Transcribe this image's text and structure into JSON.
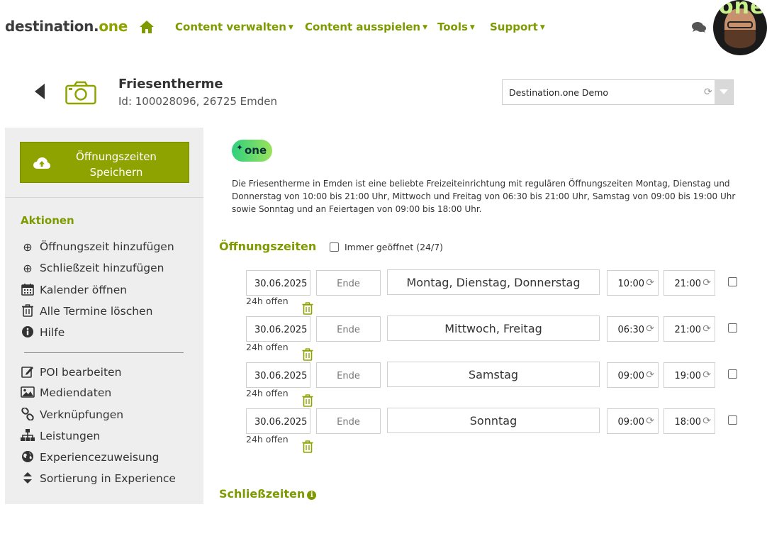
{
  "header": {
    "logo_main": "destination.",
    "logo_accent": "one",
    "nav": [
      {
        "label": "Content verwalten"
      },
      {
        "label": "Content ausspielen"
      },
      {
        "label": "Tools"
      },
      {
        "label": "Support"
      }
    ],
    "avatar_badge": "one"
  },
  "poi": {
    "title": "Friesentherme",
    "id_line": "Id: 100028096, 26725 Emden",
    "experience_value": "Destination.one Demo"
  },
  "sidebar": {
    "save_label": "Öffnungszeiten Speichern",
    "actions_heading": "Aktionen",
    "actions": [
      {
        "label": "Öffnungszeit hinzufügen",
        "icon": "plus-circle-icon"
      },
      {
        "label": "Schließzeit hinzufügen",
        "icon": "plus-circle-icon"
      },
      {
        "label": "Kalender öffnen",
        "icon": "calendar-icon"
      },
      {
        "label": "Alle Termine löschen",
        "icon": "trash-icon"
      },
      {
        "label": "Hilfe",
        "icon": "info-circle-icon"
      }
    ],
    "links": [
      {
        "label": "POI bearbeiten",
        "icon": "edit-icon"
      },
      {
        "label": "Mediendaten",
        "icon": "image-icon"
      },
      {
        "label": "Verknüpfungen",
        "icon": "link-icon"
      },
      {
        "label": "Leistungen",
        "icon": "sitemap-icon"
      },
      {
        "label": "Experiencezuweisung",
        "icon": "globe-icon"
      },
      {
        "label": "Sortierung in Experience",
        "icon": "sort-icon"
      }
    ]
  },
  "main": {
    "ai_badge": "one",
    "ai_description": "Die Friesentherme in Emden ist eine beliebte Freizeiteinrichtung mit regulären Öffnungszeiten Montag, Dienstag und Donnerstag von 10:00 bis 21:00 Uhr, Mittwoch und Freitag von 06:30 bis 21:00 Uhr, Samstag von 09:00 bis 19:00 Uhr sowie Sonntag und an Feiertagen von 09:00 bis 18:00 Uhr.",
    "opening_title": "Öffnungszeiten",
    "always_open_label": "Immer geöffnet (24/7)",
    "closing_title": "Schließzeiten",
    "rows": [
      {
        "start": "30.06.2025",
        "end_placeholder": "Ende",
        "days": "Montag, Dienstag, Donnerstag",
        "from": "10:00",
        "to": "21:00",
        "open24": "24h offen"
      },
      {
        "start": "30.06.2025",
        "end_placeholder": "Ende",
        "days": "Mittwoch, Freitag",
        "from": "06:30",
        "to": "21:00",
        "open24": "24h offen"
      },
      {
        "start": "30.06.2025",
        "end_placeholder": "Ende",
        "days": "Samstag",
        "from": "09:00",
        "to": "19:00",
        "open24": "24h offen"
      },
      {
        "start": "30.06.2025",
        "end_placeholder": "Ende",
        "days": "Sonntag",
        "from": "09:00",
        "to": "18:00",
        "open24": "24h offen"
      }
    ]
  },
  "colors": {
    "brand": "#8fa300",
    "brand_text": "#7d9a00",
    "sidebar_bg": "#eeeeee"
  }
}
